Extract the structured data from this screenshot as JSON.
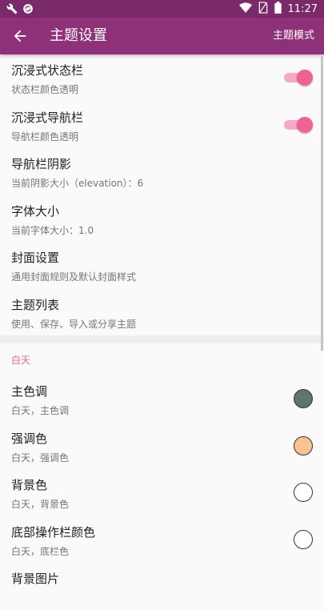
{
  "status_bar": {
    "time": "11:27",
    "left_icons": [
      "wrench-icon",
      "sync-icon"
    ],
    "right_icons": [
      "wifi-icon",
      "no-sim-icon",
      "battery-icon"
    ]
  },
  "toolbar": {
    "back_icon": "arrow-left-icon",
    "title": "主题设置",
    "mode_label": "主题模式"
  },
  "settings": {
    "immersive_status": {
      "title": "沉浸式状态栏",
      "subtitle": "状态栏颜色透明",
      "enabled": true
    },
    "immersive_nav": {
      "title": "沉浸式导航栏",
      "subtitle": "导航栏颜色透明",
      "enabled": true
    },
    "nav_shadow": {
      "title": "导航栏阴影",
      "subtitle": "当前阴影大小（elevation）：6"
    },
    "font_size": {
      "title": "字体大小",
      "subtitle": "当前字体大小：1.0"
    },
    "cover": {
      "title": "封面设置",
      "subtitle": "通用封面规则及默认封面样式"
    },
    "theme_list": {
      "title": "主题列表",
      "subtitle": "使用、保存、导入或分享主题"
    }
  },
  "day_section": {
    "header": "白天",
    "primary": {
      "title": "主色调",
      "subtitle": "白天，主色调",
      "color": "#5e7568"
    },
    "accent": {
      "title": "强调色",
      "subtitle": "白天，强调色",
      "color": "#f7c38e"
    },
    "background": {
      "title": "背景色",
      "subtitle": "白天，背景色",
      "color": "#ffffff"
    },
    "bottom_bar": {
      "title": "底部操作栏颜色",
      "subtitle": "白天，底栏色",
      "color": "#ffffff"
    },
    "bg_image": {
      "title": "背景图片"
    }
  }
}
